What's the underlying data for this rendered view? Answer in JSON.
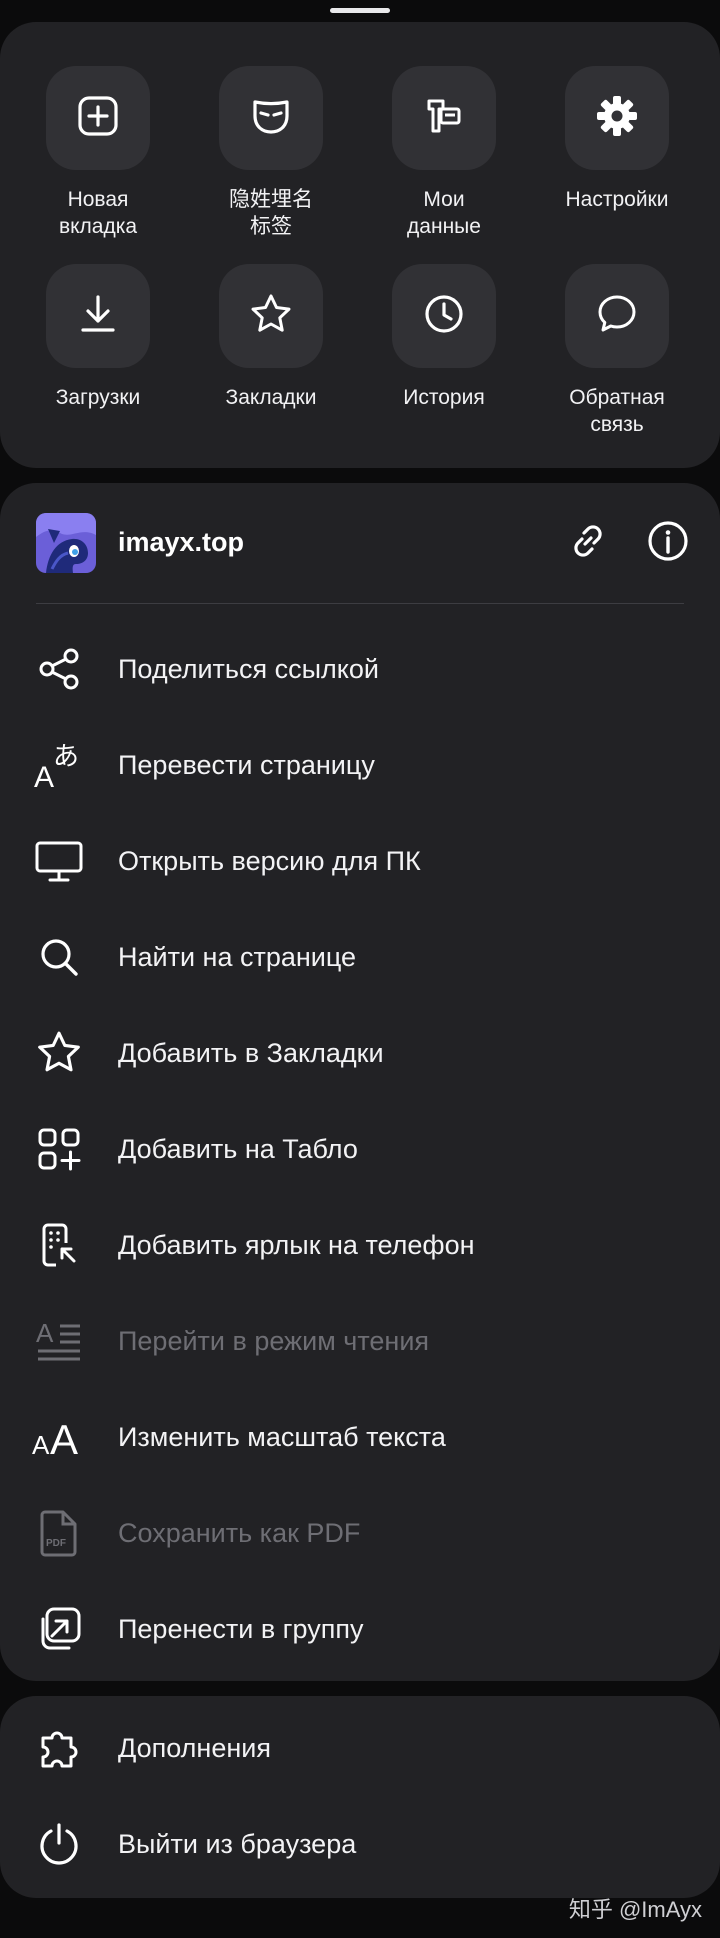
{
  "quick_actions": [
    {
      "label": "Новая\nвкладка",
      "icon": "new-tab-icon"
    },
    {
      "label": "隐姓埋名\n标签",
      "icon": "incognito-mask-icon"
    },
    {
      "label": "Мои\nданные",
      "icon": "my-data-icon"
    },
    {
      "label": "Настройки",
      "icon": "gear-icon"
    },
    {
      "label": "Загрузки",
      "icon": "download-icon"
    },
    {
      "label": "Закладки",
      "icon": "star-icon"
    },
    {
      "label": "История",
      "icon": "clock-icon"
    },
    {
      "label": "Обратная\nсвязь",
      "icon": "chat-bubble-icon"
    }
  ],
  "site": {
    "title": "imayx.top"
  },
  "menu": [
    {
      "label": "Поделиться ссылкой",
      "icon": "share-icon",
      "enabled": true
    },
    {
      "label": "Перевести страницу",
      "icon": "translate-icon",
      "enabled": true
    },
    {
      "label": "Открыть версию для ПК",
      "icon": "desktop-icon",
      "enabled": true
    },
    {
      "label": "Найти на странице",
      "icon": "search-icon",
      "enabled": true
    },
    {
      "label": "Добавить в Закладки",
      "icon": "star-icon",
      "enabled": true
    },
    {
      "label": "Добавить на Табло",
      "icon": "tiles-add-icon",
      "enabled": true
    },
    {
      "label": "Добавить ярлык на телефон",
      "icon": "phone-shortcut-icon",
      "enabled": true
    },
    {
      "label": "Перейти в режим чтения",
      "icon": "reader-mode-icon",
      "enabled": false
    },
    {
      "label": "Изменить масштаб текста",
      "icon": "text-size-icon",
      "enabled": true
    },
    {
      "label": "Сохранить как PDF",
      "icon": "pdf-icon",
      "enabled": false
    },
    {
      "label": "Перенести в группу",
      "icon": "move-to-group-icon",
      "enabled": true
    }
  ],
  "bottom_menu": [
    {
      "label": "Дополнения",
      "icon": "puzzle-icon"
    },
    {
      "label": "Выйти из браузера",
      "icon": "power-icon"
    }
  ],
  "watermark": "知乎 @ImAyx",
  "colors": {
    "background": "#0b0b0c",
    "card": "#222225",
    "tile": "#313135",
    "text": "#f3f3f5",
    "disabled": "#6e6e74"
  }
}
